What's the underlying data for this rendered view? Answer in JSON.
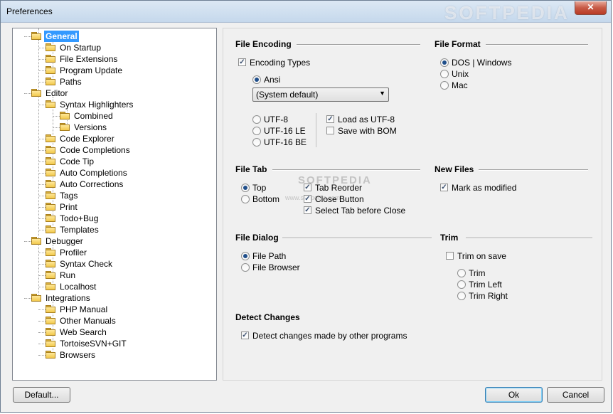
{
  "window": {
    "title": "Preferences",
    "close_glyph": "✕",
    "watermark": "SOFTPEDIA"
  },
  "tree": {
    "items": [
      {
        "label": "General",
        "level": 0,
        "selected": true
      },
      {
        "label": "On Startup",
        "level": 1
      },
      {
        "label": "File Extensions",
        "level": 1
      },
      {
        "label": "Program Update",
        "level": 1
      },
      {
        "label": "Paths",
        "level": 1
      },
      {
        "label": "Editor",
        "level": 0
      },
      {
        "label": "Syntax Highlighters",
        "level": 1
      },
      {
        "label": "Combined",
        "level": 2
      },
      {
        "label": "Versions",
        "level": 2
      },
      {
        "label": "Code Explorer",
        "level": 1
      },
      {
        "label": "Code Completions",
        "level": 1
      },
      {
        "label": "Code Tip",
        "level": 1
      },
      {
        "label": "Auto Completions",
        "level": 1
      },
      {
        "label": "Auto Corrections",
        "level": 1
      },
      {
        "label": "Tags",
        "level": 1
      },
      {
        "label": "Print",
        "level": 1
      },
      {
        "label": "Todo+Bug",
        "level": 1
      },
      {
        "label": "Templates",
        "level": 1
      },
      {
        "label": "Debugger",
        "level": 0
      },
      {
        "label": "Profiler",
        "level": 1
      },
      {
        "label": "Syntax Check",
        "level": 1
      },
      {
        "label": "Run",
        "level": 1
      },
      {
        "label": "Localhost",
        "level": 1
      },
      {
        "label": "Integrations",
        "level": 0
      },
      {
        "label": "PHP Manual",
        "level": 1
      },
      {
        "label": "Other Manuals",
        "level": 1
      },
      {
        "label": "Web Search",
        "level": 1
      },
      {
        "label": "TortoiseSVN+GIT",
        "level": 1
      },
      {
        "label": "Browsers",
        "level": 1
      }
    ]
  },
  "file_encoding": {
    "title": "File Encoding",
    "encoding_types": {
      "label": "Encoding Types",
      "checked": true
    },
    "ansi": {
      "label": "Ansi",
      "selected": true
    },
    "codepage": {
      "value": "(System default)"
    },
    "utf8": {
      "label": "UTF-8",
      "selected": false
    },
    "utf16le": {
      "label": "UTF-16 LE",
      "selected": false
    },
    "utf16be": {
      "label": "UTF-16 BE",
      "selected": false
    },
    "load_as_utf8": {
      "label": "Load as UTF-8",
      "checked": true
    },
    "save_with_bom": {
      "label": "Save with BOM",
      "checked": false
    }
  },
  "file_format": {
    "title": "File Format",
    "dos": {
      "label": "DOS | Windows",
      "selected": true
    },
    "unix": {
      "label": "Unix",
      "selected": false
    },
    "mac": {
      "label": "Mac",
      "selected": false
    }
  },
  "file_tab": {
    "title": "File Tab",
    "top": {
      "label": "Top",
      "selected": true
    },
    "bottom": {
      "label": "Bottom",
      "selected": false
    },
    "tab_reorder": {
      "label": "Tab Reorder",
      "checked": true
    },
    "close_button": {
      "label": "Close Button",
      "checked": true
    },
    "select_tab_before_close": {
      "label": "Select Tab before Close",
      "checked": true
    },
    "ghost_text_1": "SOFTPEDIA",
    "ghost_text_2": "www.softpedia.com"
  },
  "new_files": {
    "title": "New Files",
    "mark_as_modified": {
      "label": "Mark as modified",
      "checked": true
    }
  },
  "file_dialog": {
    "title": "File Dialog",
    "file_path": {
      "label": "File Path",
      "selected": true
    },
    "file_browser": {
      "label": "File Browser",
      "selected": false
    }
  },
  "trim": {
    "title": "Trim",
    "trim_on_save": {
      "label": "Trim on save",
      "checked": false
    },
    "trim": {
      "label": "Trim",
      "selected": false
    },
    "trim_left": {
      "label": "Trim Left",
      "selected": false
    },
    "trim_right": {
      "label": "Trim Right",
      "selected": false
    }
  },
  "detect_changes": {
    "title": "Detect Changes",
    "detect_other_programs": {
      "label": "Detect changes made by other programs",
      "checked": true
    }
  },
  "buttons": {
    "default": "Default...",
    "ok": "Ok",
    "cancel": "Cancel"
  },
  "colors": {
    "selection": "#3399ff",
    "folder": "#f2c94c",
    "titlebar": "#c5d8ec",
    "close": "#c75a46"
  }
}
